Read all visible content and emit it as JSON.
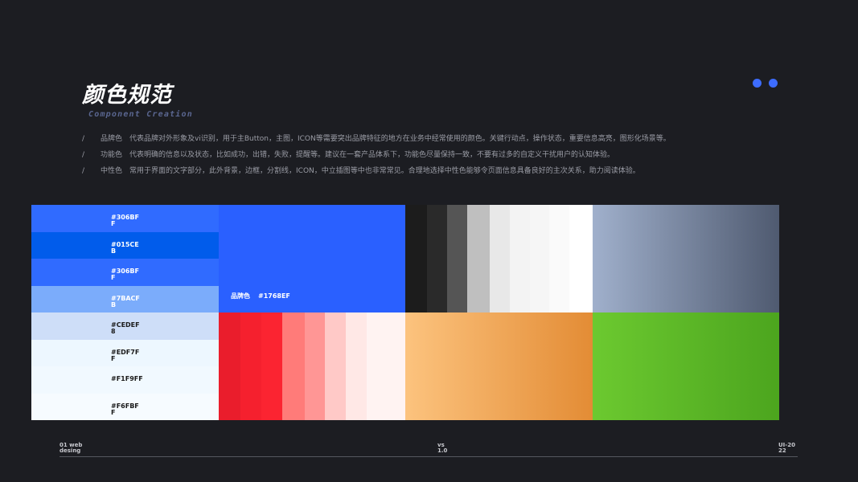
{
  "header": {
    "title": "颜色规范",
    "subtitle": "Component Creation",
    "dots_color": "#3d6cff"
  },
  "descriptions": [
    {
      "slash": "/",
      "term": "品牌色",
      "text": "代表品牌对外形象及vi识别，用于主Button，主图，ICON等需要突出品牌特征的地方在业务中经常使用的颜色。关键行动点，操作状态，重要信息高亮，图形化场景等。"
    },
    {
      "slash": "/",
      "term": "功能色",
      "text": "代表明确的信息以及状态，比如成功，出错，失败，提醒等。建议在一套产品体系下，功能色尽量保持一致，不要有过多的自定义干扰用户的认知体验。"
    },
    {
      "slash": "/",
      "term": "中性色",
      "text": "常用于界面的文字部分，此外背景，边框，分割线，ICON，中立插图等中也非常常见。合理地选择中性色能够令页面信息具备良好的主次关系，助力阅读体验。"
    }
  ],
  "brand_swatches": [
    {
      "code": "#306BFF",
      "color": "#306bff",
      "text": "light"
    },
    {
      "code": "#015CEB",
      "color": "#015ceb",
      "text": "light"
    },
    {
      "code": "#306BFF",
      "color": "#306bff",
      "text": "light"
    },
    {
      "code": "#7BACFB",
      "color": "#7bacfb",
      "text": "light"
    },
    {
      "code": "#CEDEF8",
      "color": "#cedef8",
      "text": "dark"
    },
    {
      "code": "#EDF7FF",
      "color": "#edf7ff",
      "text": "dark"
    },
    {
      "code": "#F1F9FF",
      "color": "#f1f9ff",
      "text": "dark"
    },
    {
      "code": "#F6FBFF",
      "color": "#f6fbff",
      "text": "dark"
    }
  ],
  "main_brand": {
    "label": "品牌色",
    "code": "#1768EF",
    "color": "#2a60ff"
  },
  "grays": [
    "#1c1c1c",
    "#2a2a2a",
    "#555555",
    "#bfbfbf",
    "#e8e8e8",
    "#f3f3f3",
    "#f6f6f6",
    "#fafafa",
    "#ffffff"
  ],
  "gray_widths": [
    27,
    25,
    25,
    28,
    25,
    25,
    24,
    25,
    26
  ],
  "reds": [
    "#ea1d2c",
    "#f5202e",
    "#fb2431",
    "#ff7b79",
    "#ff9695",
    "#ffc9c7",
    "#ffe8e6",
    "#fff3f2"
  ],
  "red_widths": [
    27,
    26,
    26,
    28,
    25,
    26,
    26,
    48
  ],
  "footer": {
    "left": "01 web desing",
    "middle": "vs1.0",
    "right": "UI-2022"
  }
}
